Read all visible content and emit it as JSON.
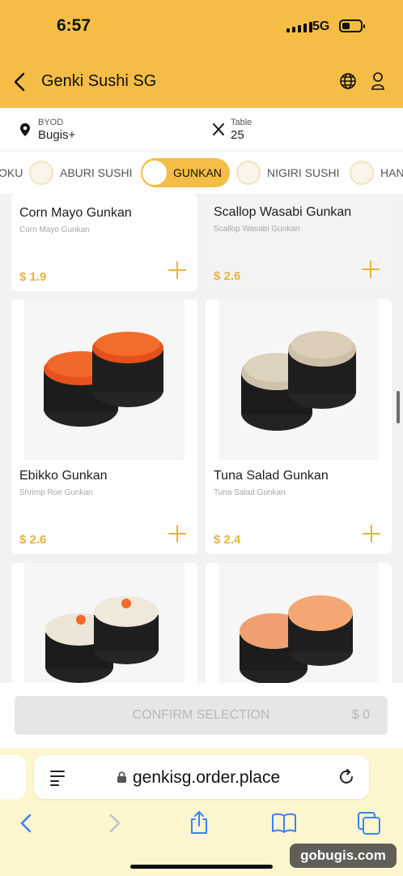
{
  "status_bar": {
    "time": "6:57",
    "network": "5G"
  },
  "header": {
    "title": "Genki Sushi SG"
  },
  "location": {
    "byod_label": "BYOD",
    "byod_value": "Bugis+",
    "table_label": "Table",
    "table_value": "25"
  },
  "categories": [
    {
      "label": "OKU",
      "active": false
    },
    {
      "label": "ABURI SUSHI",
      "active": false
    },
    {
      "label": "GUNKAN",
      "active": true
    },
    {
      "label": "NIGIRI SUSHI",
      "active": false
    },
    {
      "label": "HAN",
      "active": false
    }
  ],
  "items": [
    {
      "name": "Corn Mayo Gunkan",
      "subtitle": "Corn Mayo Gunkan",
      "price": "$ 1.9"
    },
    {
      "name": "Scallop Wasabi Gunkan",
      "subtitle": "Scallop Wasabi Gunkan",
      "price": "$ 2.6"
    },
    {
      "name": "Ebikko Gunkan",
      "subtitle": "Shrimp Roe Gunkan",
      "price": "$ 2.6"
    },
    {
      "name": "Tuna Salad Gunkan",
      "subtitle": "Tuna Salad Gunkan",
      "price": "$ 2.4"
    }
  ],
  "confirm": {
    "label": "CONFIRM SELECTION",
    "amount": "$ 0"
  },
  "browser": {
    "url": "genkisg.order.place"
  },
  "watermark": "gobugis.com",
  "colors": {
    "accent": "#f5bd45",
    "price": "#e7b23f",
    "browser_bar": "#fdf6cf"
  }
}
